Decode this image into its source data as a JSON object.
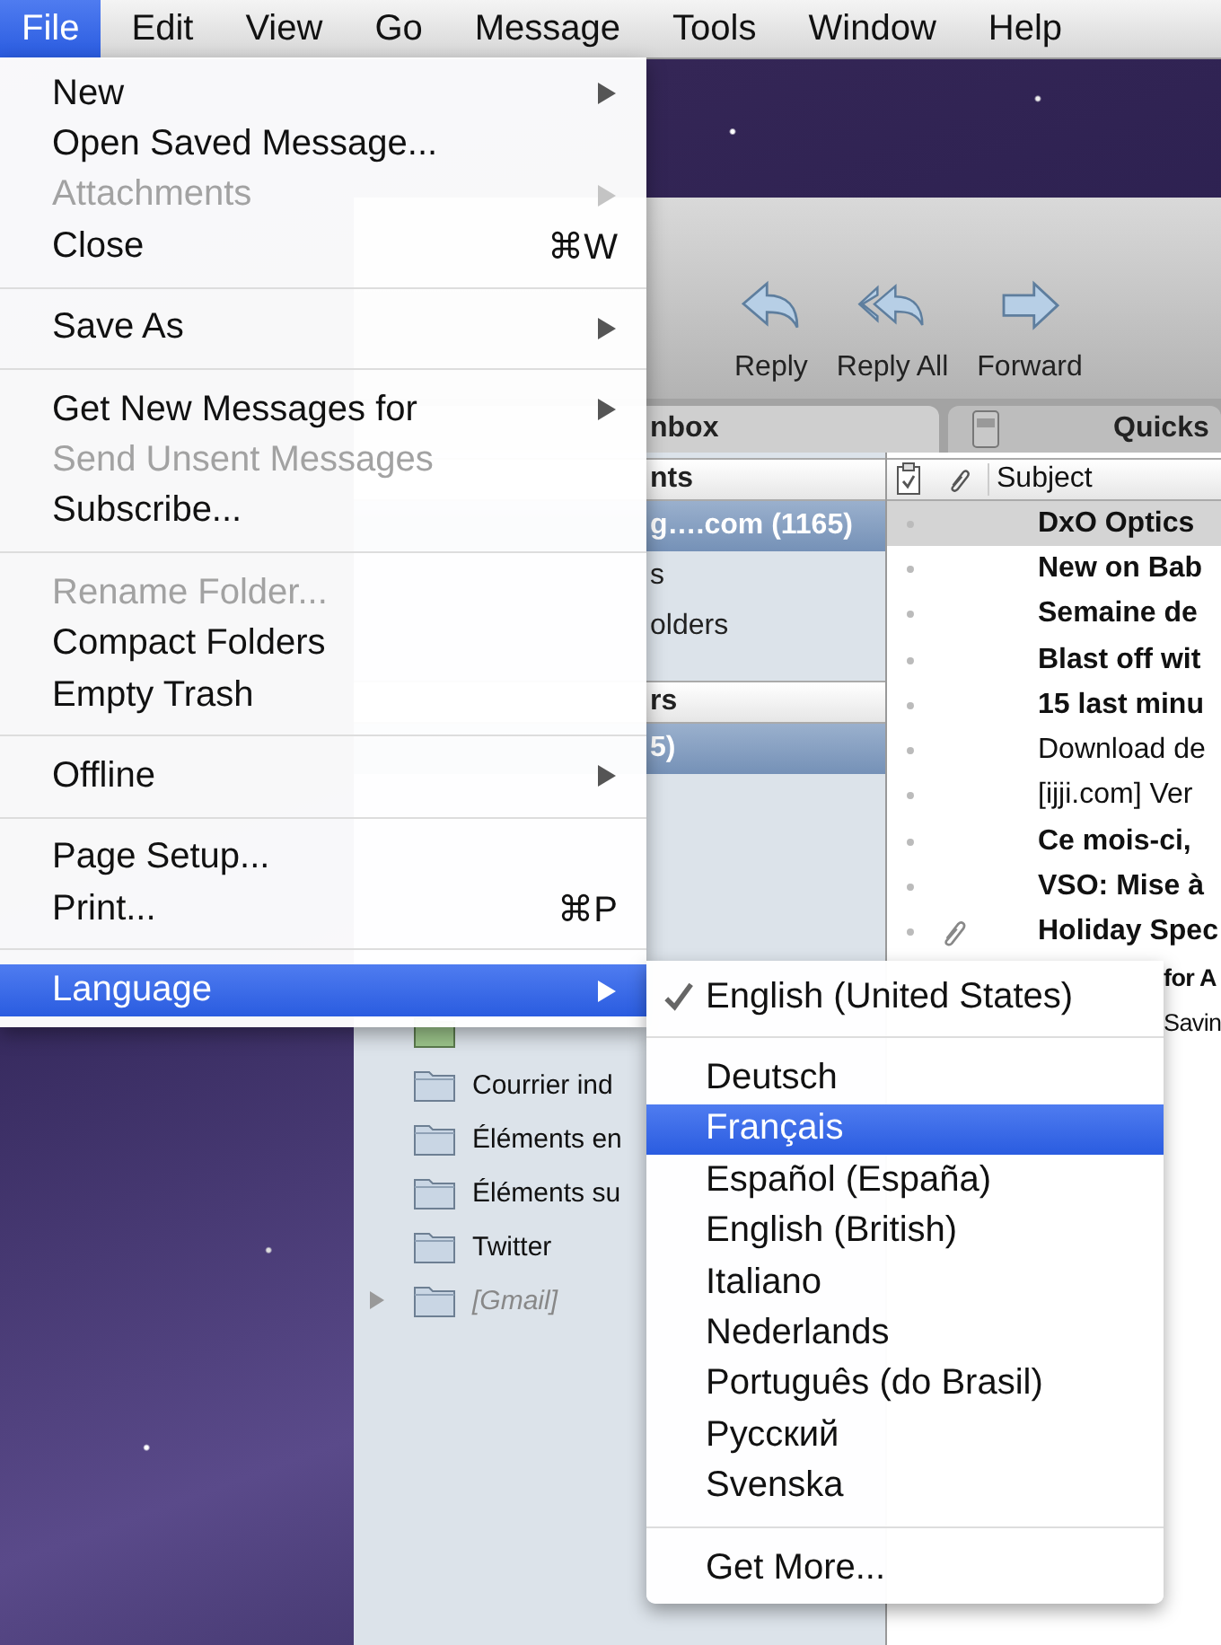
{
  "menu_bar": [
    {
      "label": "File",
      "selected": true
    },
    {
      "label": "Edit",
      "selected": false
    },
    {
      "label": "View",
      "selected": false
    },
    {
      "label": "Go",
      "selected": false
    },
    {
      "label": "Message",
      "selected": false
    },
    {
      "label": "Tools",
      "selected": false
    },
    {
      "label": "Window",
      "selected": false
    },
    {
      "label": "Help",
      "selected": false
    }
  ],
  "app_window": {
    "toolbar": [
      {
        "label": "Reply",
        "kind": "reply"
      },
      {
        "label": "Reply All",
        "kind": "reply_all"
      },
      {
        "label": "Forward",
        "kind": "forward"
      }
    ],
    "tabs": [
      {
        "label": "nbox",
        "selected": true
      },
      {
        "label": "Quicks",
        "selected": false
      }
    ],
    "sidebar": {
      "accounts_header": "nts",
      "accounts": [
        {
          "label": "g….com (1165)",
          "selected": true
        },
        {
          "label": "s",
          "selected": false
        },
        {
          "label": "olders",
          "selected": false
        }
      ],
      "folders_header": "rs",
      "top_folders": [
        {
          "label": "5)",
          "selected": true
        }
      ],
      "folders": [
        {
          "label": "Courrier ind",
          "kind": "folder"
        },
        {
          "label": "Éléments en",
          "kind": "folder"
        },
        {
          "label": "Éléments su",
          "kind": "folder"
        },
        {
          "label": "Twitter",
          "kind": "folder"
        },
        {
          "label": "[Gmail]",
          "kind": "account"
        }
      ]
    },
    "message_list": {
      "subject_header": "Subject",
      "rows": [
        {
          "subject": "DxO Optics",
          "unread": true,
          "attachment": false,
          "selected": true,
          "kind": "full"
        },
        {
          "subject": "New on Bab",
          "unread": true,
          "attachment": false,
          "selected": false,
          "kind": "full"
        },
        {
          "subject": "Semaine de",
          "unread": true,
          "attachment": false,
          "selected": false,
          "kind": "full"
        },
        {
          "subject": "Blast off wit",
          "unread": true,
          "attachment": false,
          "selected": false,
          "kind": "full"
        },
        {
          "subject": "15 last minu",
          "unread": true,
          "attachment": false,
          "selected": false,
          "kind": "full"
        },
        {
          "subject": "Download de",
          "unread": false,
          "attachment": false,
          "selected": false,
          "kind": "full"
        },
        {
          "subject": "[ijji.com] Ver",
          "unread": false,
          "attachment": false,
          "selected": false,
          "kind": "full"
        },
        {
          "subject": "Ce mois-ci,",
          "unread": true,
          "attachment": false,
          "selected": false,
          "kind": "full"
        },
        {
          "subject": "VSO: Mise à",
          "unread": true,
          "attachment": false,
          "selected": false,
          "kind": "full"
        },
        {
          "subject": "Holiday Spec",
          "unread": true,
          "attachment": true,
          "selected": false,
          "kind": "full"
        },
        {
          "subject": "for A",
          "unread": true,
          "attachment": false,
          "selected": false,
          "kind": "covered"
        },
        {
          "subject": "Savin",
          "unread": false,
          "attachment": false,
          "selected": false,
          "kind": "covered"
        }
      ]
    }
  },
  "file_menu": {
    "groups": [
      [
        {
          "label": "New",
          "submenu": true,
          "disabled": false,
          "selected": false
        },
        {
          "label": "Open Saved Message...",
          "submenu": false,
          "disabled": false,
          "selected": false
        },
        {
          "label": "Attachments",
          "submenu": true,
          "disabled": true,
          "selected": false
        },
        {
          "label": "Close",
          "shortcut": "⌘W",
          "submenu": false,
          "disabled": false,
          "selected": false
        }
      ],
      [
        {
          "label": "Save As",
          "submenu": true,
          "disabled": false,
          "selected": false
        }
      ],
      [
        {
          "label": "Get New Messages for",
          "submenu": true,
          "disabled": false,
          "selected": false
        },
        {
          "label": "Send Unsent Messages",
          "submenu": false,
          "disabled": true,
          "selected": false
        },
        {
          "label": "Subscribe...",
          "submenu": false,
          "disabled": false,
          "selected": false
        }
      ],
      [
        {
          "label": "Rename Folder...",
          "submenu": false,
          "disabled": true,
          "selected": false
        },
        {
          "label": "Compact Folders",
          "submenu": false,
          "disabled": false,
          "selected": false
        },
        {
          "label": "Empty Trash",
          "submenu": false,
          "disabled": false,
          "selected": false
        }
      ],
      [
        {
          "label": "Offline",
          "submenu": true,
          "disabled": false,
          "selected": false
        }
      ],
      [
        {
          "label": "Page Setup...",
          "submenu": false,
          "disabled": false,
          "selected": false
        },
        {
          "label": "Print...",
          "shortcut": "⌘P",
          "submenu": false,
          "disabled": false,
          "selected": false
        }
      ],
      [
        {
          "label": "Language",
          "submenu": true,
          "disabled": false,
          "selected": true
        }
      ]
    ]
  },
  "language_menu": {
    "groups": [
      [
        {
          "label": "English (United States)",
          "checked": true,
          "selected": false
        }
      ],
      [
        {
          "label": "Deutsch",
          "checked": false,
          "selected": false
        },
        {
          "label": "Français",
          "checked": false,
          "selected": true
        },
        {
          "label": "Español (España)",
          "checked": false,
          "selected": false
        },
        {
          "label": "English (British)",
          "checked": false,
          "selected": false
        },
        {
          "label": "Italiano",
          "checked": false,
          "selected": false
        },
        {
          "label": "Nederlands",
          "checked": false,
          "selected": false
        },
        {
          "label": "Português (do Brasil)",
          "checked": false,
          "selected": false
        },
        {
          "label": "Русский",
          "checked": false,
          "selected": false
        },
        {
          "label": "Svenska",
          "checked": false,
          "selected": false
        }
      ],
      [
        {
          "label": "Get More...",
          "checked": false,
          "selected": false
        }
      ]
    ]
  }
}
